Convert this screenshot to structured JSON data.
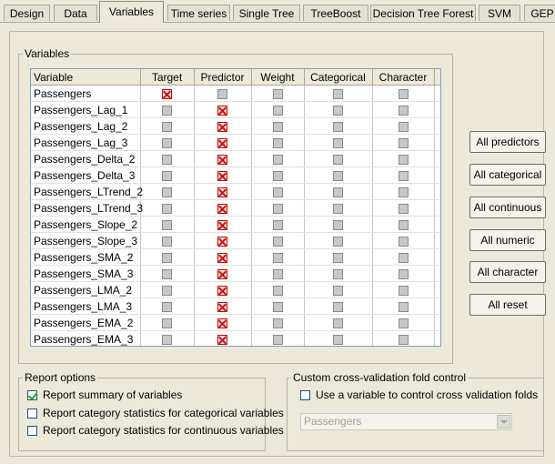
{
  "tabs": [
    "Design",
    "Data",
    "Variables",
    "Time series",
    "Single Tree",
    "TreeBoost",
    "Decision Tree Forest",
    "SVM",
    "GEP"
  ],
  "active_tab": 2,
  "variables": {
    "group_label": "Variables",
    "columns": [
      "Variable",
      "Target",
      "Predictor",
      "Weight",
      "Categorical",
      "Character"
    ],
    "rows": [
      {
        "name": "Passengers",
        "target": true,
        "predictor": false
      },
      {
        "name": "Passengers_Lag_1",
        "target": false,
        "predictor": true
      },
      {
        "name": "Passengers_Lag_2",
        "target": false,
        "predictor": true
      },
      {
        "name": "Passengers_Lag_3",
        "target": false,
        "predictor": true
      },
      {
        "name": "Passengers_Delta_2",
        "target": false,
        "predictor": true
      },
      {
        "name": "Passengers_Delta_3",
        "target": false,
        "predictor": true
      },
      {
        "name": "Passengers_LTrend_2",
        "target": false,
        "predictor": true
      },
      {
        "name": "Passengers_LTrend_3",
        "target": false,
        "predictor": true
      },
      {
        "name": "Passengers_Slope_2",
        "target": false,
        "predictor": true
      },
      {
        "name": "Passengers_Slope_3",
        "target": false,
        "predictor": true
      },
      {
        "name": "Passengers_SMA_2",
        "target": false,
        "predictor": true
      },
      {
        "name": "Passengers_SMA_3",
        "target": false,
        "predictor": true
      },
      {
        "name": "Passengers_LMA_2",
        "target": false,
        "predictor": true
      },
      {
        "name": "Passengers_LMA_3",
        "target": false,
        "predictor": true
      },
      {
        "name": "Passengers_EMA_2",
        "target": false,
        "predictor": true
      },
      {
        "name": "Passengers_EMA_3",
        "target": false,
        "predictor": true
      }
    ]
  },
  "buttons": {
    "all_predictors": "All predictors",
    "all_categorical": "All categorical",
    "all_continuous": "All continuous",
    "all_numeric": "All numeric",
    "all_character": "All character",
    "all_reset": "All reset"
  },
  "report_options": {
    "label": "Report options",
    "summary": {
      "label": "Report summary of variables",
      "checked": true
    },
    "categorical": {
      "label": "Report category statistics for categorical variables",
      "checked": false
    },
    "continuous": {
      "label": "Report category statistics for continuous variables",
      "checked": false
    }
  },
  "cross_validation": {
    "label": "Custom cross-validation fold control",
    "use_variable": {
      "label": "Use a variable to control cross validation folds",
      "checked": false
    },
    "variable_select": "Passengers"
  }
}
